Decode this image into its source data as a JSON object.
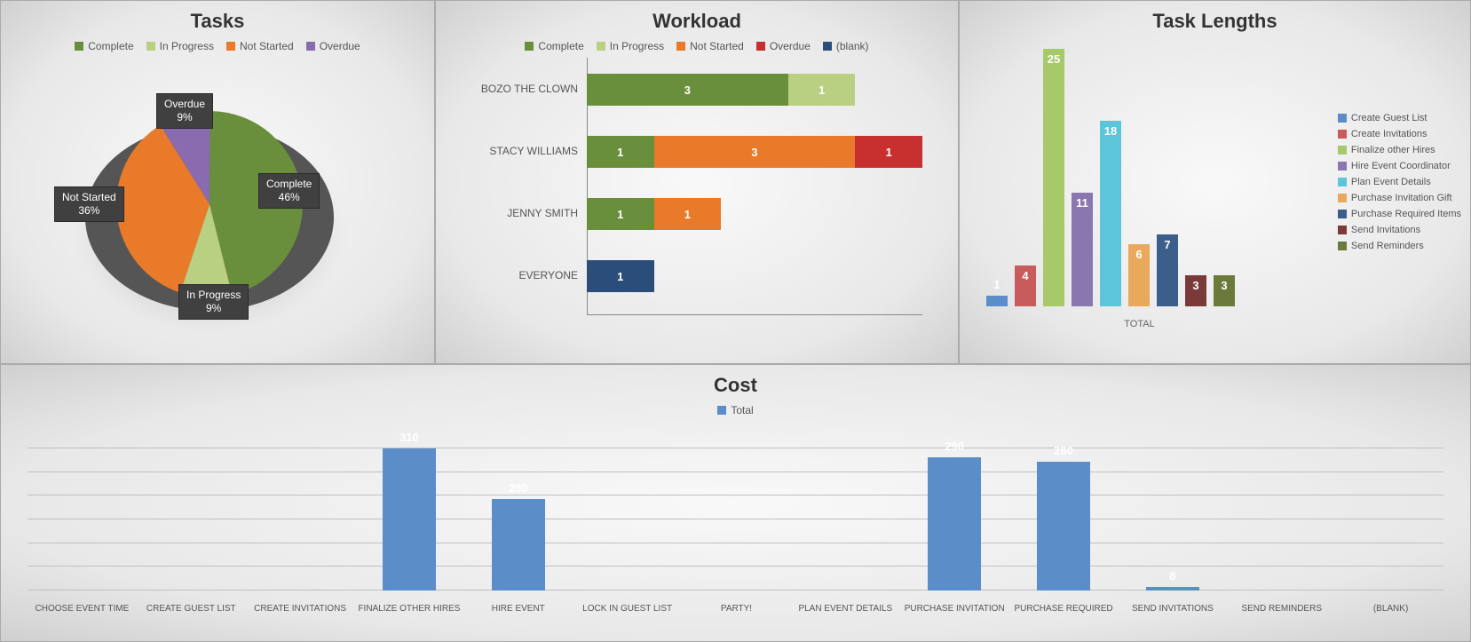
{
  "tasks": {
    "title": "Tasks",
    "legend": [
      "Complete",
      "In Progress",
      "Not Started",
      "Overdue"
    ],
    "colors": {
      "Complete": "#6a8f3c",
      "In Progress": "#b9d083",
      "Not Started": "#e87a2a",
      "Overdue": "#8a6bb0"
    },
    "labels": {
      "complete": "Complete\n46%",
      "inprogress": "In Progress\n9%",
      "notstarted": "Not Started\n36%",
      "overdue": "Overdue\n9%"
    }
  },
  "workload": {
    "title": "Workload",
    "legend": [
      "Complete",
      "In Progress",
      "Not Started",
      "Overdue",
      "(blank)"
    ],
    "colors": {
      "Complete": "#6a8f3c",
      "In Progress": "#b9d083",
      "Not Started": "#e87a2a",
      "Overdue": "#c83030",
      "(blank)": "#2a4d7a"
    },
    "rows": [
      {
        "name": "BOZO THE CLOWN",
        "segs": [
          {
            "k": "Complete",
            "v": 3
          },
          {
            "k": "In Progress",
            "v": 1
          }
        ]
      },
      {
        "name": "STACY WILLIAMS",
        "segs": [
          {
            "k": "Complete",
            "v": 1
          },
          {
            "k": "Not Started",
            "v": 3
          },
          {
            "k": "Overdue",
            "v": 1
          }
        ]
      },
      {
        "name": "JENNY SMITH",
        "segs": [
          {
            "k": "Complete",
            "v": 1
          },
          {
            "k": "Not Started",
            "v": 1
          }
        ]
      },
      {
        "name": "EVERYONE",
        "segs": [
          {
            "k": "(blank)",
            "v": 1
          }
        ]
      }
    ],
    "max": 5
  },
  "tasklengths": {
    "title": "Task Lengths",
    "xlabel": "TOTAL",
    "items": [
      {
        "name": "Create Guest List",
        "v": 1,
        "color": "#5b8dc8"
      },
      {
        "name": "Create Invitations",
        "v": 4,
        "color": "#c85c5c"
      },
      {
        "name": "Finalize other Hires",
        "v": 25,
        "color": "#a6c96a"
      },
      {
        "name": "Hire Event Coordinator",
        "v": 11,
        "color": "#8a77b0"
      },
      {
        "name": "Plan Event Details",
        "v": 18,
        "color": "#5cc5d8"
      },
      {
        "name": "Purchase Invitation Gift",
        "v": 6,
        "color": "#e9a95c"
      },
      {
        "name": "Purchase Required Items",
        "v": 7,
        "color": "#3b5f8a"
      },
      {
        "name": "Send Invitations",
        "v": 3,
        "color": "#7a3a3a"
      },
      {
        "name": "Send Reminders",
        "v": 3,
        "color": "#6a7a3a"
      }
    ],
    "max": 25
  },
  "cost": {
    "title": "Cost",
    "series_label": "Total",
    "color": "#5b8dc8",
    "categories": [
      "CHOOSE EVENT TIME",
      "CREATE GUEST LIST",
      "CREATE INVITATIONS",
      "FINALIZE OTHER HIRES",
      "HIRE EVENT",
      "LOCK IN GUEST LIST",
      "PARTY!",
      "PLAN EVENT DETAILS",
      "PURCHASE INVITATION",
      "PURCHASE REQUIRED",
      "SEND INVITATIONS",
      "SEND REMINDERS",
      "(BLANK)"
    ],
    "values": [
      0,
      0,
      0,
      310,
      200,
      0,
      0,
      0,
      290,
      280,
      8,
      0,
      0
    ],
    "max": 310
  },
  "chart_data": [
    {
      "type": "pie",
      "title": "Tasks",
      "series": [
        {
          "name": "Complete",
          "value": 46
        },
        {
          "name": "In Progress",
          "value": 9
        },
        {
          "name": "Not Started",
          "value": 36
        },
        {
          "name": "Overdue",
          "value": 9
        }
      ],
      "unit": "percent"
    },
    {
      "type": "bar",
      "orientation": "horizontal",
      "stacked": true,
      "title": "Workload",
      "categories": [
        "BOZO THE CLOWN",
        "STACY WILLIAMS",
        "JENNY SMITH",
        "EVERYONE"
      ],
      "series": [
        {
          "name": "Complete",
          "values": [
            3,
            1,
            1,
            0
          ]
        },
        {
          "name": "In Progress",
          "values": [
            1,
            0,
            0,
            0
          ]
        },
        {
          "name": "Not Started",
          "values": [
            0,
            3,
            1,
            0
          ]
        },
        {
          "name": "Overdue",
          "values": [
            0,
            1,
            0,
            0
          ]
        },
        {
          "name": "(blank)",
          "values": [
            0,
            0,
            0,
            1
          ]
        }
      ],
      "xlim": [
        0,
        5
      ]
    },
    {
      "type": "bar",
      "title": "Task Lengths",
      "categories": [
        "Create Guest List",
        "Create Invitations",
        "Finalize other Hires",
        "Hire Event Coordinator",
        "Plan Event Details",
        "Purchase Invitation Gift",
        "Purchase Required Items",
        "Send Invitations",
        "Send Reminders"
      ],
      "values": [
        1,
        4,
        25,
        11,
        18,
        6,
        7,
        3,
        3
      ],
      "xlabel": "TOTAL",
      "ylim": [
        0,
        25
      ]
    },
    {
      "type": "bar",
      "title": "Cost",
      "series_name": "Total",
      "categories": [
        "CHOOSE EVENT TIME",
        "CREATE GUEST LIST",
        "CREATE INVITATIONS",
        "FINALIZE OTHER HIRES",
        "HIRE EVENT",
        "LOCK IN GUEST LIST",
        "PARTY!",
        "PLAN EVENT DETAILS",
        "PURCHASE INVITATION",
        "PURCHASE REQUIRED",
        "SEND INVITATIONS",
        "SEND REMINDERS",
        "(BLANK)"
      ],
      "values": [
        0,
        0,
        0,
        310,
        200,
        0,
        0,
        0,
        290,
        280,
        8,
        0,
        0
      ],
      "ylim": [
        0,
        350
      ]
    }
  ]
}
